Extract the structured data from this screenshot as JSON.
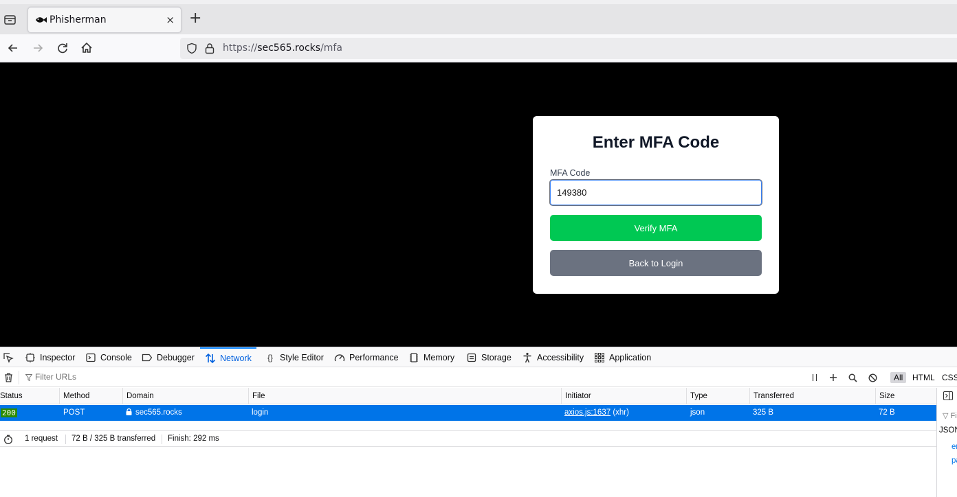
{
  "browser": {
    "tab": {
      "title": "Phisherman",
      "favicon": "fish-icon",
      "close_glyph": "×"
    },
    "new_tab_glyph": "+",
    "url": {
      "scheme": "https://",
      "host": "sec565.rocks",
      "path": "/mfa"
    }
  },
  "page": {
    "card": {
      "title": "Enter MFA Code",
      "field_label": "MFA Code",
      "field_value": "149380",
      "verify_button": "Verify MFA",
      "back_button": "Back to Login"
    },
    "colors": {
      "verify": "#00c853",
      "back": "#6b7280",
      "background": "#000000"
    }
  },
  "devtools": {
    "tabs": [
      {
        "label": "Inspector",
        "icon": "inspector-icon"
      },
      {
        "label": "Console",
        "icon": "console-icon"
      },
      {
        "label": "Debugger",
        "icon": "debugger-icon"
      },
      {
        "label": "Network",
        "icon": "network-icon",
        "active": true
      },
      {
        "label": "Style Editor",
        "icon": "style-editor-icon"
      },
      {
        "label": "Performance",
        "icon": "performance-icon"
      },
      {
        "label": "Memory",
        "icon": "memory-icon"
      },
      {
        "label": "Storage",
        "icon": "storage-icon"
      },
      {
        "label": "Accessibility",
        "icon": "accessibility-icon"
      },
      {
        "label": "Application",
        "icon": "application-icon"
      }
    ],
    "filter_placeholder": "Filter URLs",
    "type_filters": [
      "All",
      "HTML",
      "CSS"
    ],
    "columns": [
      "Status",
      "Method",
      "Domain",
      "File",
      "Initiator",
      "Type",
      "Transferred",
      "Size"
    ],
    "rows": [
      {
        "status": "200",
        "method": "POST",
        "domain": "sec565.rocks",
        "file": "login",
        "initiator_link": "axios.js:1637",
        "initiator_suffix": " (xhr)",
        "type": "json",
        "transferred": "325 B",
        "size": "72 B"
      }
    ],
    "summary": {
      "requests": "1 request",
      "transferred": "72 B / 325 B transferred",
      "finish": "Finish: 292 ms"
    },
    "side_panel": {
      "filter": "Filter",
      "json_label": "JSON",
      "key1": "error",
      "key2": "password"
    }
  }
}
